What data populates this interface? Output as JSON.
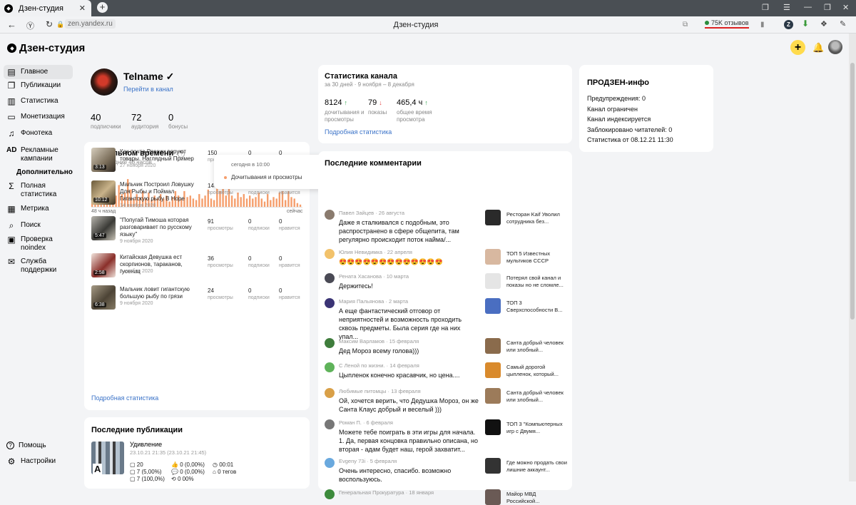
{
  "browser": {
    "tab_title": "Дзен-студия",
    "url": "zen.yandex.ru",
    "page_title": "Дзен-студия",
    "reviews": "75K отзывов"
  },
  "app": {
    "logo": "Дзен-студия"
  },
  "sidebar": {
    "items": [
      {
        "label": "Главное",
        "icon": "home-icon",
        "glyph": "▤"
      },
      {
        "label": "Публикации",
        "icon": "publications-icon",
        "glyph": "❐"
      },
      {
        "label": "Статистика",
        "icon": "stats-icon",
        "glyph": "▥"
      },
      {
        "label": "Монетизация",
        "icon": "monetization-icon",
        "glyph": "▭"
      },
      {
        "label": "Фонотека",
        "icon": "music-icon",
        "glyph": "♫"
      },
      {
        "label": "Рекламные кампании",
        "icon": "ads-icon",
        "glyph": "AD"
      },
      {
        "label": "Дополнительно",
        "icon": "",
        "glyph": ""
      },
      {
        "label": "Полная статистика",
        "icon": "sigma-icon",
        "glyph": "Σ"
      },
      {
        "label": "Метрика",
        "icon": "metrika-icon",
        "glyph": "▦"
      },
      {
        "label": "Поиск",
        "icon": "search-icon",
        "glyph": "⌕"
      },
      {
        "label": "Проверка noindex",
        "icon": "check-icon",
        "glyph": "▣"
      },
      {
        "label": "Служба поддержки",
        "icon": "mail-icon",
        "glyph": "✉"
      }
    ],
    "bottom": [
      {
        "label": "Помощь",
        "icon": "help-icon",
        "glyph": "?"
      },
      {
        "label": "Настройки",
        "icon": "settings-icon",
        "glyph": "⚙"
      }
    ]
  },
  "profile": {
    "name": "Telname",
    "check": "✓",
    "link": "Перейти в канал",
    "stats": [
      {
        "value": "40",
        "label": "подписчики"
      },
      {
        "value": "72",
        "label": "аудитория"
      },
      {
        "value": "0",
        "label": "бонусы"
      }
    ]
  },
  "realtime": {
    "title": "В реальном времени",
    "subtitle": "за последние 48 часов",
    "axis_left": "48 ч назад",
    "axis_right": "сейчас",
    "tooltip_time": "сегодня в 10:00",
    "tooltip_label": "Дочитывания и просмотры",
    "tooltip_value": "13",
    "bars": [
      0.55,
      0.7,
      0.3,
      0.6,
      0.35,
      0.55,
      0.45,
      0.65,
      0.4,
      0.75,
      0.45,
      0.5,
      0.95,
      0.6,
      0.3,
      0.45,
      0.35,
      0.55,
      0.3,
      0.5,
      0.25,
      0.4,
      0.3,
      0.45,
      0.3,
      0.4,
      0.2,
      0.35,
      0.55,
      0.4,
      0.3,
      0.55,
      0.35,
      0.4,
      0.3,
      0.25,
      0.45,
      0.3,
      0.4,
      0.6,
      0.3,
      0.25,
      0.95,
      0.55,
      0.75,
      0.4,
      0.85,
      0.4,
      0.3,
      0.5,
      0.35,
      0.45,
      0.3,
      0.4,
      0.3,
      0.35,
      0.5,
      0.3,
      0.2,
      0.45,
      0.25,
      0.35,
      0.3,
      0.5,
      0.55,
      0.25,
      0.55,
      0.35,
      0.3,
      0.15,
      0.1
    ],
    "videos": [
      {
        "title": "Как почта России воруют товары. Наглядный Пример",
        "date": "27 ноября 2020",
        "duration": "3:13",
        "views": "150",
        "subs": "0",
        "likes": "0"
      },
      {
        "title": "Мальчик Построил Ловушку Для Рыбы и Поймал Гигантскую рыбу В Норе",
        "date": "14 ноября 2020",
        "duration": "10:12",
        "views": "140",
        "subs": "0",
        "likes": "0"
      },
      {
        "title": "\"Попугай Тимоша которая разговаривает по русскому языку\"",
        "date": "9 ноября 2020",
        "duration": "5:47",
        "views": "91",
        "subs": "0",
        "likes": "0"
      },
      {
        "title": "Китайская Девушка ест скорпионов, тараканов, гусениц",
        "date": "9 ноября 2020",
        "duration": "2:58",
        "views": "36",
        "subs": "0",
        "likes": "0"
      },
      {
        "title": "Мальчик ловит гигантскую большую рыбу по грязи",
        "date": "9 ноября 2020",
        "duration": "6:38",
        "views": "24",
        "subs": "0",
        "likes": "0"
      }
    ],
    "views_label": "просмотры",
    "subs_label": "подписки",
    "likes_label": "нравится",
    "more_link": "Подробная статистика"
  },
  "latest": {
    "title": "Последние публикации",
    "item_title": "Удивление",
    "item_date": "23.10.21 21:35 (23.10.21 21:45)",
    "m1": "20",
    "m2": "7 (5,00%)",
    "m3": "7 (100,0%)",
    "m4": "0 (0,00%)",
    "m5": "0 (0,00%)",
    "m6": "0 00%",
    "m7": "00:01",
    "m8": "0 тегов"
  },
  "channel": {
    "title": "Статистика канала",
    "subtitle": "за 30 дней · 9 ноября – 8 декабря",
    "metrics": [
      {
        "value": "8124",
        "trend": "↑",
        "trend_dir": "up",
        "label": "дочитывания и просмотры"
      },
      {
        "value": "79",
        "trend": "↓",
        "trend_dir": "down",
        "label": "показы"
      },
      {
        "value": "465,4 ч",
        "trend": "↑",
        "trend_dir": "up",
        "label": "общее время просмотра"
      }
    ],
    "more_link": "Подробная статистика"
  },
  "comments": {
    "title": "Последние комментарии",
    "items": [
      {
        "author": "Павел Зайцев · 26 августа",
        "text": "Даже я сталкивался с подобным, это распространено в сфере общепита, там регулярно происходит поток найма/...",
        "post": "Ресторан Kaif Уволил сотрудника без..."
      },
      {
        "author": "Юлия Невидимка · 22 апреля",
        "text": "😍😍😍😍😍😍😍😍😍😍😍😍😍",
        "post": "ТОП 5 Известных мультиков СССР"
      },
      {
        "author": "Рената Хасанова · 10 марта",
        "text": "Держитесь!",
        "post": "Потерял свой канал и показы но не сломле..."
      },
      {
        "author": "Мария Пальянова · 2 марта",
        "text": "А еще фантастический отговор от неприятностей и возможность проходить сквозь предметы. Была серия где на них упал...",
        "post": "ТОП 3 Сверхспособности В..."
      },
      {
        "author": "Максим Варламов · 15 февраля",
        "text": "Дед Мороз всему голова)))",
        "post": "Санта добрый человек или злобный..."
      },
      {
        "author": "С Леной по жизни. · 14 февраля",
        "text": "Цыпленок конечно красавчик, но цена....",
        "post": "Самый дорогой цыпленок, который..."
      },
      {
        "author": "Любимые питомцы · 13 февраля",
        "text": "Ой, хочется верить, что Дедушка Мороз, он же Санта Клаус добрый и веселый )))",
        "post": "Санта добрый человек или злобный..."
      },
      {
        "author": "Роман П. · 6 февраля",
        "text": "Можете тебе поиграть в эти игры для начала. 1. Да, первая концовка правильно описана, но вторая - адам будет наш, герой захватит...",
        "post": "ТОП 3 \"Компьютерных игр с Двумя..."
      },
      {
        "author": "Evgeny 73i · 5 февраля",
        "text": "Очень интересно, спасибо. возможно воспользуюсь.",
        "post": "Где можно продать свои лишние аккаунт..."
      },
      {
        "author": "Генеральная Прокуратура · 18 января",
        "text": "",
        "post": "Майор МВД Российской..."
      }
    ]
  },
  "prozen": {
    "title": "ПРОДЗЕН-инфо",
    "lines": [
      "Предупреждения: 0",
      "Канал ограничен",
      "Канал индексируется",
      "Заблокировано читателей: 0",
      "Статистика от 08.12.21 11:30"
    ]
  },
  "colors": {
    "accent": "#3b73c8",
    "bar": "#f59e6c",
    "yellow": "#ffdb4d",
    "up": "#2ea34b",
    "down": "#e24545"
  }
}
